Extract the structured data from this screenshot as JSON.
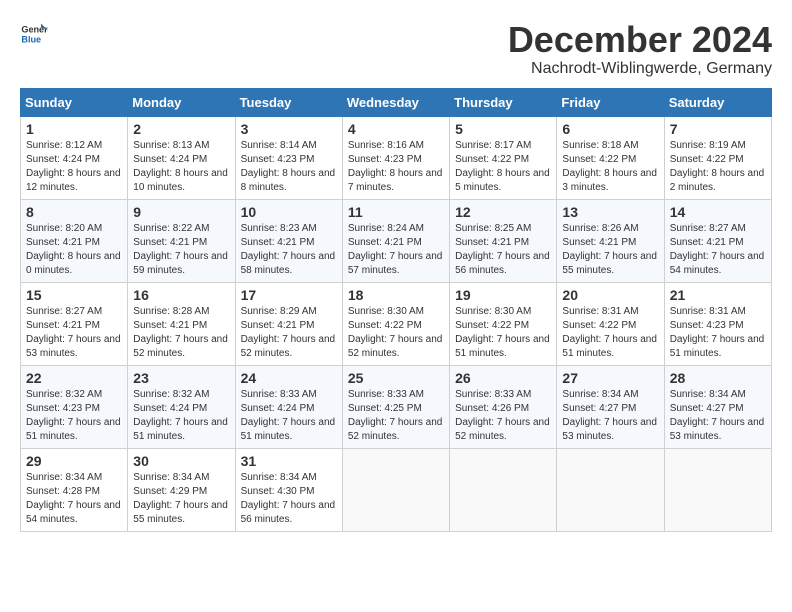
{
  "header": {
    "logo_general": "General",
    "logo_blue": "Blue",
    "title": "December 2024",
    "subtitle": "Nachrodt-Wiblingwerde, Germany"
  },
  "calendar": {
    "headers": [
      "Sunday",
      "Monday",
      "Tuesday",
      "Wednesday",
      "Thursday",
      "Friday",
      "Saturday"
    ],
    "weeks": [
      [
        {
          "day": "1",
          "sunrise": "8:12 AM",
          "sunset": "4:24 PM",
          "daylight": "8 hours and 12 minutes."
        },
        {
          "day": "2",
          "sunrise": "8:13 AM",
          "sunset": "4:24 PM",
          "daylight": "8 hours and 10 minutes."
        },
        {
          "day": "3",
          "sunrise": "8:14 AM",
          "sunset": "4:23 PM",
          "daylight": "8 hours and 8 minutes."
        },
        {
          "day": "4",
          "sunrise": "8:16 AM",
          "sunset": "4:23 PM",
          "daylight": "8 hours and 7 minutes."
        },
        {
          "day": "5",
          "sunrise": "8:17 AM",
          "sunset": "4:22 PM",
          "daylight": "8 hours and 5 minutes."
        },
        {
          "day": "6",
          "sunrise": "8:18 AM",
          "sunset": "4:22 PM",
          "daylight": "8 hours and 3 minutes."
        },
        {
          "day": "7",
          "sunrise": "8:19 AM",
          "sunset": "4:22 PM",
          "daylight": "8 hours and 2 minutes."
        }
      ],
      [
        {
          "day": "8",
          "sunrise": "8:20 AM",
          "sunset": "4:21 PM",
          "daylight": "8 hours and 0 minutes."
        },
        {
          "day": "9",
          "sunrise": "8:22 AM",
          "sunset": "4:21 PM",
          "daylight": "7 hours and 59 minutes."
        },
        {
          "day": "10",
          "sunrise": "8:23 AM",
          "sunset": "4:21 PM",
          "daylight": "7 hours and 58 minutes."
        },
        {
          "day": "11",
          "sunrise": "8:24 AM",
          "sunset": "4:21 PM",
          "daylight": "7 hours and 57 minutes."
        },
        {
          "day": "12",
          "sunrise": "8:25 AM",
          "sunset": "4:21 PM",
          "daylight": "7 hours and 56 minutes."
        },
        {
          "day": "13",
          "sunrise": "8:26 AM",
          "sunset": "4:21 PM",
          "daylight": "7 hours and 55 minutes."
        },
        {
          "day": "14",
          "sunrise": "8:27 AM",
          "sunset": "4:21 PM",
          "daylight": "7 hours and 54 minutes."
        }
      ],
      [
        {
          "day": "15",
          "sunrise": "8:27 AM",
          "sunset": "4:21 PM",
          "daylight": "7 hours and 53 minutes."
        },
        {
          "day": "16",
          "sunrise": "8:28 AM",
          "sunset": "4:21 PM",
          "daylight": "7 hours and 52 minutes."
        },
        {
          "day": "17",
          "sunrise": "8:29 AM",
          "sunset": "4:21 PM",
          "daylight": "7 hours and 52 minutes."
        },
        {
          "day": "18",
          "sunrise": "8:30 AM",
          "sunset": "4:22 PM",
          "daylight": "7 hours and 52 minutes."
        },
        {
          "day": "19",
          "sunrise": "8:30 AM",
          "sunset": "4:22 PM",
          "daylight": "7 hours and 51 minutes."
        },
        {
          "day": "20",
          "sunrise": "8:31 AM",
          "sunset": "4:22 PM",
          "daylight": "7 hours and 51 minutes."
        },
        {
          "day": "21",
          "sunrise": "8:31 AM",
          "sunset": "4:23 PM",
          "daylight": "7 hours and 51 minutes."
        }
      ],
      [
        {
          "day": "22",
          "sunrise": "8:32 AM",
          "sunset": "4:23 PM",
          "daylight": "7 hours and 51 minutes."
        },
        {
          "day": "23",
          "sunrise": "8:32 AM",
          "sunset": "4:24 PM",
          "daylight": "7 hours and 51 minutes."
        },
        {
          "day": "24",
          "sunrise": "8:33 AM",
          "sunset": "4:24 PM",
          "daylight": "7 hours and 51 minutes."
        },
        {
          "day": "25",
          "sunrise": "8:33 AM",
          "sunset": "4:25 PM",
          "daylight": "7 hours and 52 minutes."
        },
        {
          "day": "26",
          "sunrise": "8:33 AM",
          "sunset": "4:26 PM",
          "daylight": "7 hours and 52 minutes."
        },
        {
          "day": "27",
          "sunrise": "8:34 AM",
          "sunset": "4:27 PM",
          "daylight": "7 hours and 53 minutes."
        },
        {
          "day": "28",
          "sunrise": "8:34 AM",
          "sunset": "4:27 PM",
          "daylight": "7 hours and 53 minutes."
        }
      ],
      [
        {
          "day": "29",
          "sunrise": "8:34 AM",
          "sunset": "4:28 PM",
          "daylight": "7 hours and 54 minutes."
        },
        {
          "day": "30",
          "sunrise": "8:34 AM",
          "sunset": "4:29 PM",
          "daylight": "7 hours and 55 minutes."
        },
        {
          "day": "31",
          "sunrise": "8:34 AM",
          "sunset": "4:30 PM",
          "daylight": "7 hours and 56 minutes."
        },
        null,
        null,
        null,
        null
      ]
    ]
  }
}
